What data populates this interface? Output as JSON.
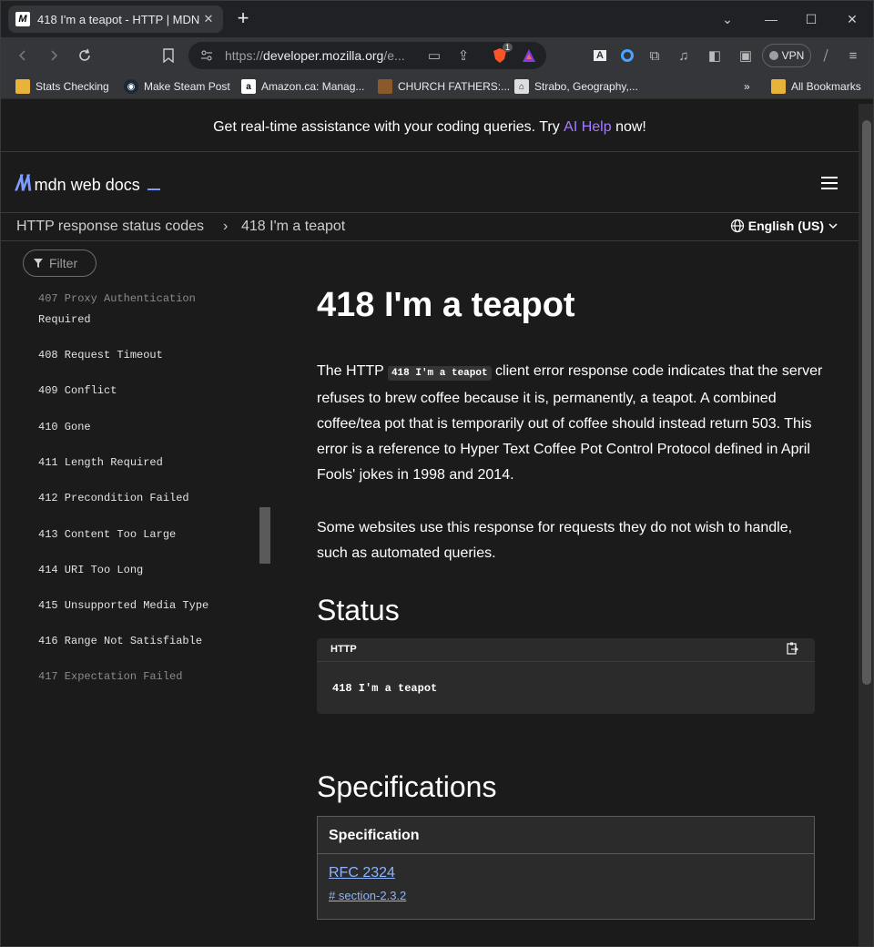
{
  "browser": {
    "tab_title": "418 I'm a teapot - HTTP | MDN",
    "url_prefix": "https://",
    "url_domain": "developer.mozilla.org",
    "url_suffix": "/e...",
    "vpn_label": "VPN",
    "brave_badge": "1"
  },
  "bookmarks": [
    "Stats Checking",
    "Make Steam Post",
    "Amazon.ca: Manag...",
    "CHURCH FATHERS:...",
    "Strabo, Geography,...",
    "All Bookmarks"
  ],
  "banner": {
    "before": "Get real-time assistance with your coding queries. Try ",
    "link": "AI Help",
    "after": " now!"
  },
  "header": {
    "logo_text": "mdn web docs"
  },
  "breadcrumbs": {
    "parent": "HTTP response status codes",
    "separator": "›",
    "current": "418 I'm a teapot",
    "language": "English (US)"
  },
  "sidebar": {
    "filter_placeholder": "Filter",
    "items": [
      "407 Proxy Authentication",
      "Required",
      "408 Request Timeout",
      "409 Conflict",
      "410 Gone",
      "411 Length Required",
      "412 Precondition Failed",
      "413 Content Too Large",
      "414 URI Too Long",
      "415 Unsupported Media Type",
      "416 Range Not Satisfiable",
      "417 Expectation Failed"
    ]
  },
  "content": {
    "title": "418 I'm a teapot",
    "p1_before": "The HTTP ",
    "p1_code": "418 I'm a teapot",
    "p1_after": " client error response code indicates that the server refuses to brew coffee because it is, permanently, a teapot. A combined coffee/tea pot that is temporarily out of coffee should instead return 503. This error is a reference to Hyper Text Coffee Pot Control Protocol defined in April Fools' jokes in 1998 and 2014.",
    "p2": "Some websites use this response for requests they do not wish to handle, such as automated queries.",
    "status_heading": "Status",
    "code_lang": "HTTP",
    "code_text": "418 I'm a teapot",
    "spec_heading": "Specifications",
    "spec_col": "Specification",
    "spec_link": "RFC 2324",
    "spec_section": "# section-2.3.2"
  },
  "icons": {
    "back": "back-arrow-icon",
    "forward": "forward-arrow-icon",
    "reload": "reload-icon",
    "bookmark": "bookmark-icon",
    "menu": "hamburger-menu-icon",
    "globe": "globe-icon",
    "copy": "copy-icon",
    "filter": "filter-icon"
  },
  "colors": {
    "accent": "#a77bff",
    "link": "#8cb4ff",
    "logo": "#7e9cff"
  }
}
